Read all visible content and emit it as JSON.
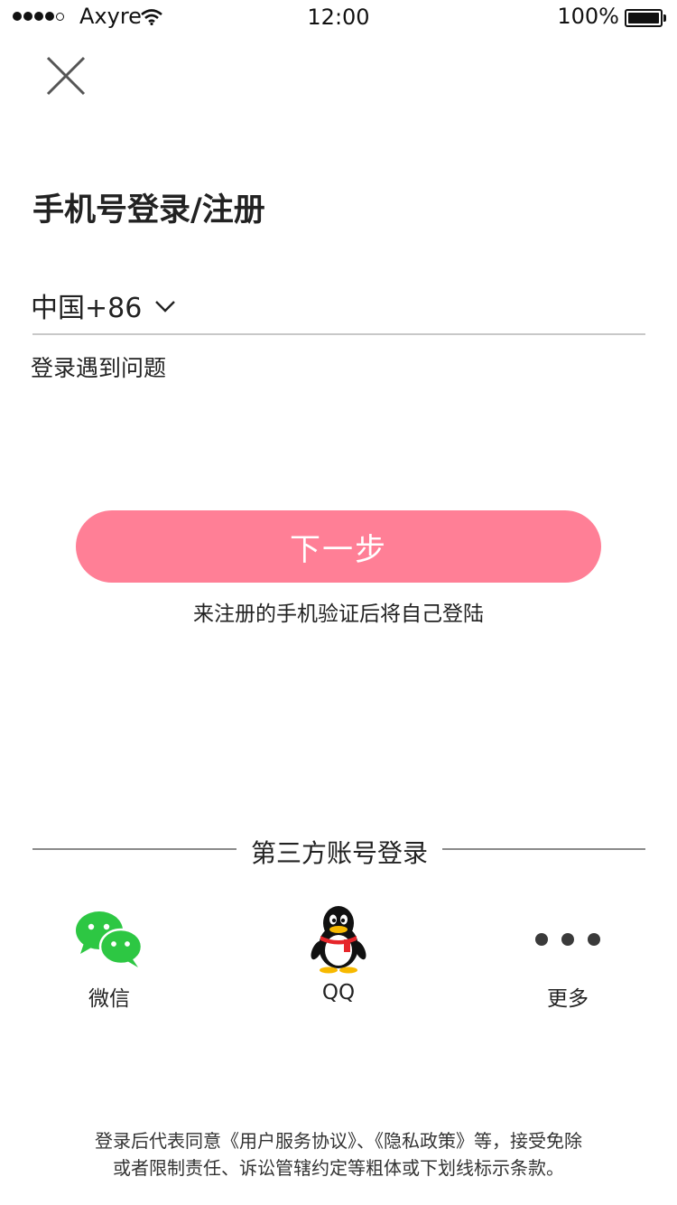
{
  "status_bar": {
    "carrier": "Axyre",
    "time": "12:00",
    "battery": "100%"
  },
  "header": {
    "title": "手机号登录/注册"
  },
  "phone": {
    "country_code": "中国+86",
    "placeholder": ""
  },
  "help_link": "登录遇到问题",
  "next_button": "下一步",
  "hint": "来注册的手机验证后将自己登陆",
  "third_party": {
    "title": "第三方账号登录",
    "items": [
      {
        "label": "微信",
        "icon": "wechat-icon"
      },
      {
        "label": "QQ",
        "icon": "qq-penguin-icon"
      },
      {
        "label": "更多",
        "icon": "more-dots-icon"
      }
    ]
  },
  "terms": {
    "line1": "登录后代表同意《用户服务协议》、《隐私政策》等，接受免除",
    "line2": "或者限制责任、诉讼管辖约定等粗体或下划线标示条款。"
  },
  "colors": {
    "primary": "#ff7f96",
    "wechat_green": "#2dc743",
    "qq_scarf": "#e6262b",
    "qq_yellow": "#f7b900"
  }
}
